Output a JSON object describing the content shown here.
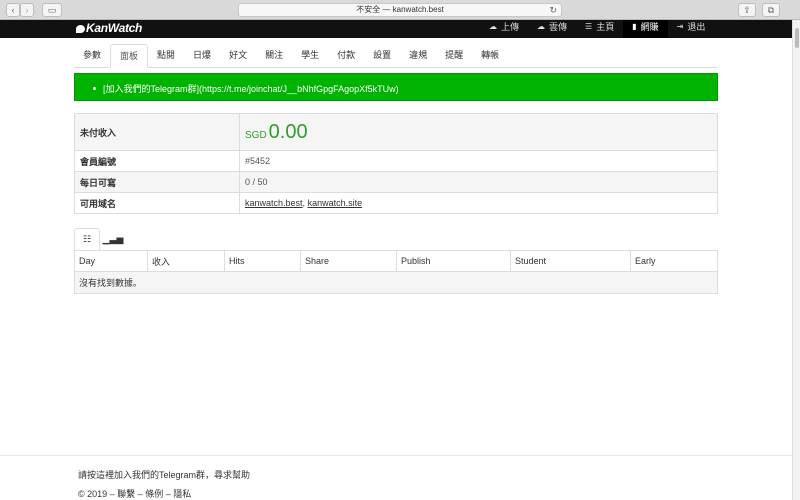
{
  "browser": {
    "url": "不安全 — kanwatch.best"
  },
  "header": {
    "logo": "KanWatch",
    "nav": [
      {
        "label": "上傳",
        "icon": "cloud-upload-icon"
      },
      {
        "label": "雲傳",
        "icon": "cloud-icon"
      },
      {
        "label": "主頁",
        "icon": "list-icon"
      },
      {
        "label": "網賺",
        "icon": "bar-chart-icon"
      },
      {
        "label": "退出",
        "icon": "logout-icon"
      }
    ]
  },
  "tabs": [
    "參數",
    "面板",
    "點閱",
    "日爆",
    "好文",
    "關注",
    "學生",
    "付款",
    "設置",
    "違規",
    "提醒",
    "轉帳"
  ],
  "active_tab": "面板",
  "alert": {
    "text": "[加入我們的Telegram群](https://t.me/joinchat/J__bNhfGpgFAgopXf5kTUw)",
    "color": "#00b300"
  },
  "info": {
    "unpaid_label": "未付收入",
    "currency": "SGD",
    "amount": "0.00",
    "member_label": "會員編號",
    "member_value": "#5452",
    "daily_label": "每日可寫",
    "daily_value": "0 / 50",
    "domain_label": "可用域名",
    "domain1": "kanwatch.best",
    "domain_sep": ", ",
    "domain2": "kanwatch.site"
  },
  "table": {
    "columns": [
      "Day",
      "收入",
      "Hits",
      "Share",
      "Publish",
      "Student",
      "Early"
    ],
    "empty": "沒有找到數據。"
  },
  "footer": {
    "line1": "請按這裡加入我們的Telegram群，尋求幫助",
    "copyright": "© 2019 – ",
    "link1": "聯繫",
    "sep1": " – ",
    "link2": "條例",
    "sep2": " – ",
    "link3": "隱私"
  }
}
